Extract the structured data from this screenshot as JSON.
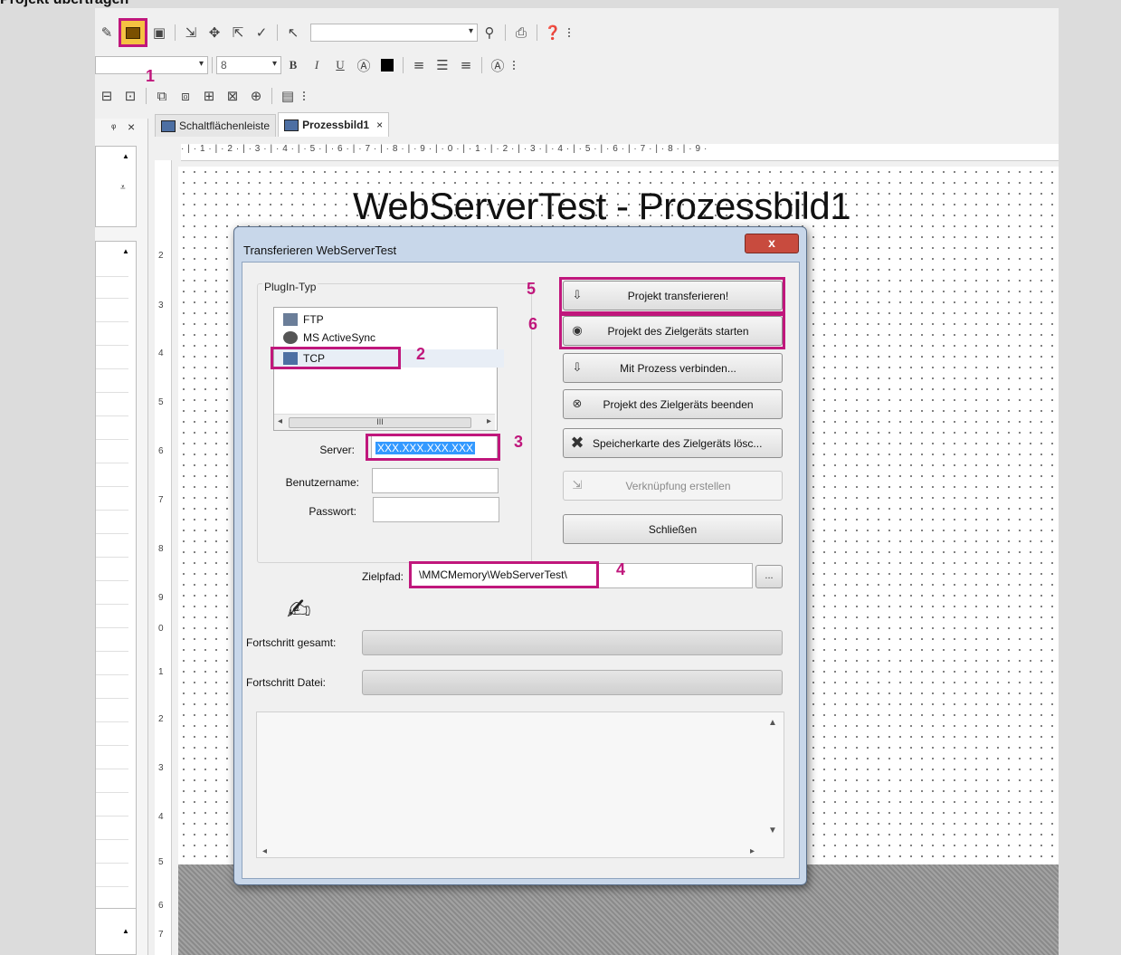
{
  "header_caption": "Projekt übertragen",
  "toolbar2": {
    "font_size": "8",
    "bold": "B",
    "italic": "I",
    "underline": "U"
  },
  "left_panel": {
    "pin": "ᵠ",
    "close": "×"
  },
  "tabs": [
    {
      "label": "Schaltflächenleiste"
    },
    {
      "label": "Prozessbild1",
      "close": "×"
    }
  ],
  "ruler_h": "·|·1·|·2·|·3·|·4·|·5·|·6·|·7·|·8·|·9·|·0·|·1·|·2·|·3·|·4·|·5·|·6·|·7·|·8·|·9·",
  "ruler_v": [
    "2",
    "3",
    "4",
    "5",
    "6",
    "7",
    "8",
    "9",
    "0",
    "1",
    "2",
    "3",
    "4",
    "5",
    "6",
    "7"
  ],
  "canvas_title": "WebServerTest - Prozessbild1",
  "dialog": {
    "title": "Transferieren WebServerTest",
    "close_label": "x",
    "group_label": "PlugIn-Typ",
    "plugins": [
      "FTP",
      "MS ActiveSync",
      "TCP"
    ],
    "scroll_thumb": "III",
    "server_label": "Server:",
    "server_value": "XXX.XXX.XXX.XXX",
    "user_label": "Benutzername:",
    "password_label": "Passwort:",
    "path_label": "Zielpfad:",
    "path_value": "\\MMCMemory\\WebServerTest\\",
    "browse_label": "...",
    "progress_total_label": "Fortschritt gesamt:",
    "progress_file_label": "Fortschritt Datei:",
    "buttons": {
      "transfer": "Projekt transferieren!",
      "start": "Projekt des Zielgeräts starten",
      "connect": "Mit Prozess verbinden...",
      "stop": "Projekt des Zielgeräts beenden",
      "clear": "Speicherkarte des Zielgeräts lösc...",
      "link": "Verknüpfung erstellen",
      "close": "Schließen"
    }
  },
  "markers": [
    "1",
    "2",
    "3",
    "4",
    "5",
    "6"
  ],
  "colors": {
    "highlight": "#c0177c",
    "accent": "#3399ff"
  }
}
